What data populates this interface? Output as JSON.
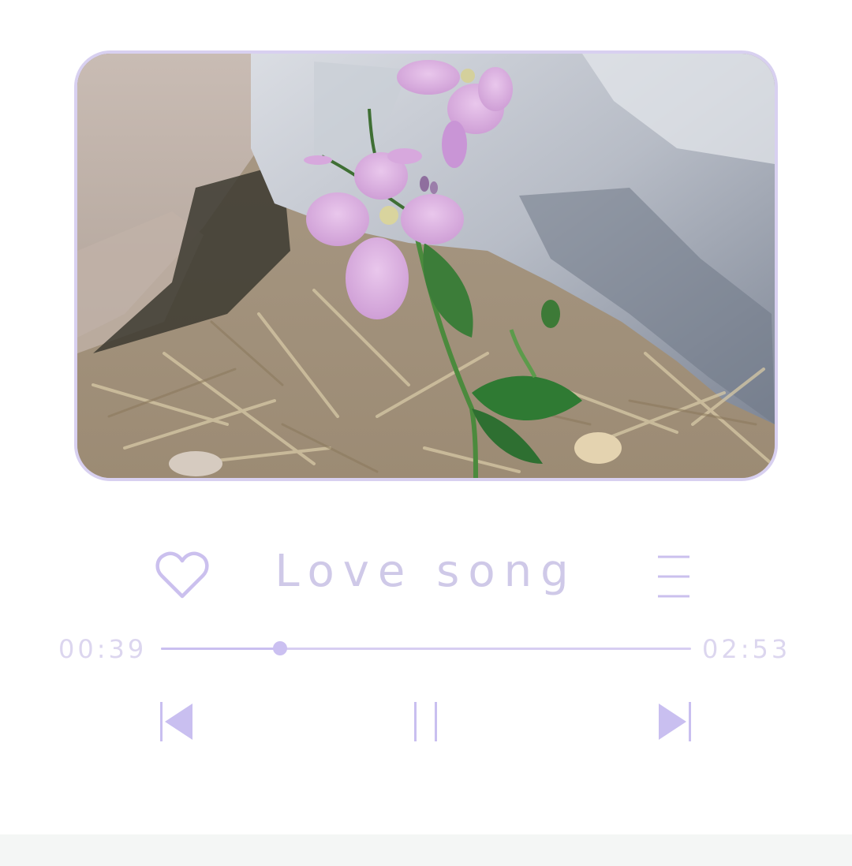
{
  "player": {
    "song_title": "Love song",
    "elapsed_time": "00:39",
    "total_time": "02:53",
    "progress_fraction": 0.225
  },
  "icons": {
    "favorite": "heart-icon",
    "playlist": "menu-icon",
    "previous": "skip-previous-icon",
    "pause": "pause-icon",
    "next": "skip-next-icon"
  },
  "colors": {
    "accent": "#c9bff0",
    "accent_light": "#dcd6ef",
    "cover_border": "#d8d0f0"
  }
}
